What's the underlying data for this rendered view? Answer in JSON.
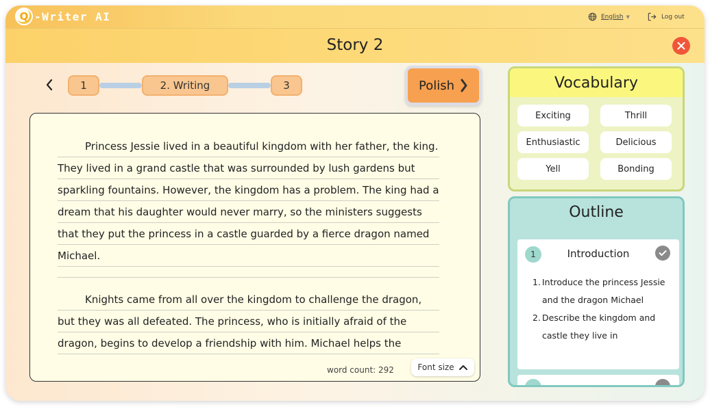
{
  "app": {
    "logo_mark": "Q",
    "logo_text": "-Writer AI"
  },
  "topbar": {
    "language": "English",
    "logout": "Log out"
  },
  "header": {
    "title": "Story 2"
  },
  "stepper": {
    "steps": [
      {
        "label": "1"
      },
      {
        "label": "2. Writing"
      },
      {
        "label": "3"
      }
    ],
    "polish_label": "Polish"
  },
  "editor": {
    "paragraphs": [
      "Princess Jessie lived in a beautiful kingdom with her father, the king. They lived in a grand castle that was surrounded by lush gardens but sparkling fountains. However, the kingdom has a problem. The king had a dream that his daughter would never marry, so the ministers suggests that they put the princess in a castle guarded by a fierce dragon named Michael.",
      "Knights came from all over the kingdom to challenge the dragon, but they was all defeated. The princess, who is initially afraid of the dragon, begins to develop a friendship with him. Michael helps the"
    ],
    "word_count": "word count: 292",
    "font_size_label": "Font size"
  },
  "vocabulary": {
    "title": "Vocabulary",
    "words": [
      "Exciting",
      "Thrill",
      "Enthusiastic",
      "Delicious",
      "Yell",
      "Bonding"
    ]
  },
  "outline": {
    "title": "Outline",
    "sections": [
      {
        "number": "1",
        "title": "Introduction",
        "items": [
          {
            "n": "1.",
            "text": "Introduce the princess Jessie and the dragon Michael"
          },
          {
            "n": "2.",
            "text": "Describe the kingdom and castle they live in"
          }
        ]
      }
    ]
  },
  "colors": {
    "accent_orange": "#f7a04f",
    "close_red": "#f0573a",
    "vocab_yellow": "#fbf77e",
    "outline_teal": "#b7e3dc"
  },
  "icons": [
    "globe-icon",
    "logout-icon",
    "close-icon",
    "chevron-left-icon",
    "chevron-right-icon",
    "chevron-up-icon",
    "check-icon"
  ]
}
